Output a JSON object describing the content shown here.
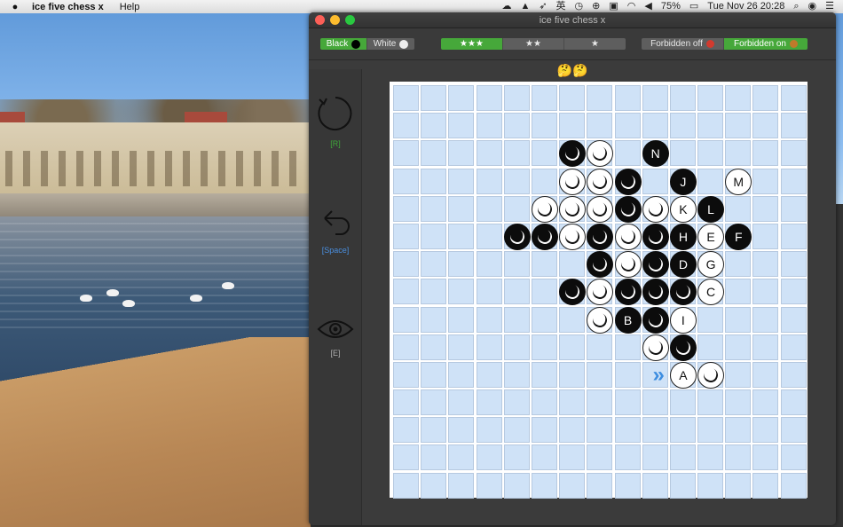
{
  "menubar": {
    "app_name": "ice five chess x",
    "menus": [
      "Help"
    ],
    "battery": "75%",
    "input_method": "英",
    "datetime": "Tue Nov 26  20:28"
  },
  "window": {
    "title": "ice five chess x"
  },
  "toolbar": {
    "color": {
      "options": [
        "Black",
        "White"
      ],
      "selected": "Black"
    },
    "difficulty": {
      "options": [
        "★★★",
        "★★",
        "★"
      ],
      "selected": "★★★"
    },
    "forbidden": {
      "options": [
        "Forbidden off",
        "Forbidden on"
      ],
      "selected": "Forbidden on"
    }
  },
  "status_emoji": "🤔🤔",
  "sidebar": {
    "restart_key": "[R]",
    "undo_key": "[Space]",
    "view_key": "[E]"
  },
  "board": {
    "size": 15,
    "stones": [
      {
        "row": 2,
        "col": 6,
        "color": "black",
        "label": ""
      },
      {
        "row": 2,
        "col": 7,
        "color": "white",
        "label": ""
      },
      {
        "row": 2,
        "col": 9,
        "color": "black",
        "label": "N"
      },
      {
        "row": 3,
        "col": 6,
        "color": "white",
        "label": ""
      },
      {
        "row": 3,
        "col": 7,
        "color": "white",
        "label": ""
      },
      {
        "row": 3,
        "col": 8,
        "color": "black",
        "label": ""
      },
      {
        "row": 3,
        "col": 10,
        "color": "black",
        "label": "J"
      },
      {
        "row": 3,
        "col": 12,
        "color": "white",
        "label": "M"
      },
      {
        "row": 4,
        "col": 5,
        "color": "white",
        "label": ""
      },
      {
        "row": 4,
        "col": 6,
        "color": "white",
        "label": ""
      },
      {
        "row": 4,
        "col": 7,
        "color": "white",
        "label": ""
      },
      {
        "row": 4,
        "col": 8,
        "color": "black",
        "label": ""
      },
      {
        "row": 4,
        "col": 9,
        "color": "white",
        "label": ""
      },
      {
        "row": 4,
        "col": 10,
        "color": "white",
        "label": "K"
      },
      {
        "row": 4,
        "col": 11,
        "color": "black",
        "label": "L"
      },
      {
        "row": 5,
        "col": 4,
        "color": "black",
        "label": ""
      },
      {
        "row": 5,
        "col": 5,
        "color": "black",
        "label": ""
      },
      {
        "row": 5,
        "col": 6,
        "color": "white",
        "label": ""
      },
      {
        "row": 5,
        "col": 7,
        "color": "black",
        "label": ""
      },
      {
        "row": 5,
        "col": 8,
        "color": "white",
        "label": ""
      },
      {
        "row": 5,
        "col": 9,
        "color": "black",
        "label": ""
      },
      {
        "row": 5,
        "col": 10,
        "color": "black",
        "label": "H"
      },
      {
        "row": 5,
        "col": 11,
        "color": "white",
        "label": "E"
      },
      {
        "row": 5,
        "col": 12,
        "color": "black",
        "label": "F"
      },
      {
        "row": 6,
        "col": 7,
        "color": "black",
        "label": ""
      },
      {
        "row": 6,
        "col": 8,
        "color": "white",
        "label": ""
      },
      {
        "row": 6,
        "col": 9,
        "color": "black",
        "label": ""
      },
      {
        "row": 6,
        "col": 10,
        "color": "black",
        "label": "D"
      },
      {
        "row": 6,
        "col": 11,
        "color": "white",
        "label": "G"
      },
      {
        "row": 7,
        "col": 6,
        "color": "black",
        "label": ""
      },
      {
        "row": 7,
        "col": 7,
        "color": "white",
        "label": ""
      },
      {
        "row": 7,
        "col": 8,
        "color": "black",
        "label": ""
      },
      {
        "row": 7,
        "col": 9,
        "color": "black",
        "label": ""
      },
      {
        "row": 7,
        "col": 10,
        "color": "black",
        "label": ""
      },
      {
        "row": 7,
        "col": 11,
        "color": "white",
        "label": "C"
      },
      {
        "row": 8,
        "col": 7,
        "color": "white",
        "label": ""
      },
      {
        "row": 8,
        "col": 8,
        "color": "black",
        "label": "B"
      },
      {
        "row": 8,
        "col": 9,
        "color": "black",
        "label": ""
      },
      {
        "row": 8,
        "col": 10,
        "color": "white",
        "label": "I"
      },
      {
        "row": 9,
        "col": 9,
        "color": "white",
        "label": ""
      },
      {
        "row": 9,
        "col": 10,
        "color": "black",
        "label": ""
      },
      {
        "row": 10,
        "col": 10,
        "color": "white",
        "label": "A"
      },
      {
        "row": 10,
        "col": 11,
        "color": "white",
        "label": ""
      }
    ],
    "last_move_marker": {
      "row": 10,
      "col": 9,
      "glyph": "»"
    }
  },
  "colors": {
    "accent_green": "#46a83a",
    "cell_blue": "#cfe2f7",
    "key_green": "#3fa83a",
    "key_blue": "#4a8fe0",
    "marker_blue": "#3d8de0"
  }
}
